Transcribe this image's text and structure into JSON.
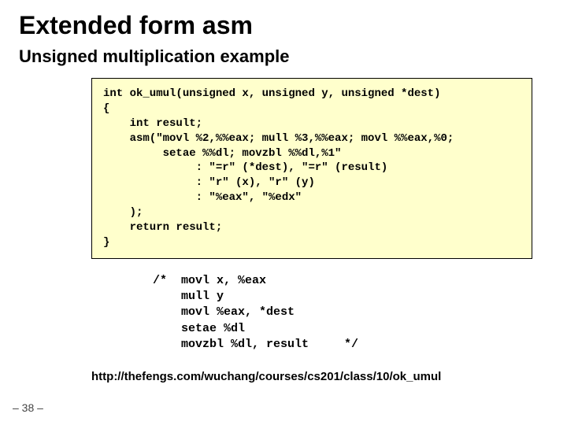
{
  "title": "Extended form asm",
  "subtitle": "Unsigned multiplication example",
  "code": "int ok_umul(unsigned x, unsigned y, unsigned *dest)\n{\n    int result;\n    asm(\"movl %2,%%eax; mull %3,%%eax; movl %%eax,%0;\n         setae %%dl; movzbl %%dl,%1\"\n              : \"=r\" (*dest), \"=r\" (result)\n              : \"r\" (x), \"r\" (y)\n              : \"%eax\", \"%edx\"\n    );\n    return result;\n}",
  "comment": "/*  movl x, %eax\n    mull y\n    movl %eax, *dest\n    setae %dl\n    movzbl %dl, result     */",
  "url": "http://thefengs.com/wuchang/courses/cs201/class/10/ok_umul",
  "pagenum": "– 38 –"
}
